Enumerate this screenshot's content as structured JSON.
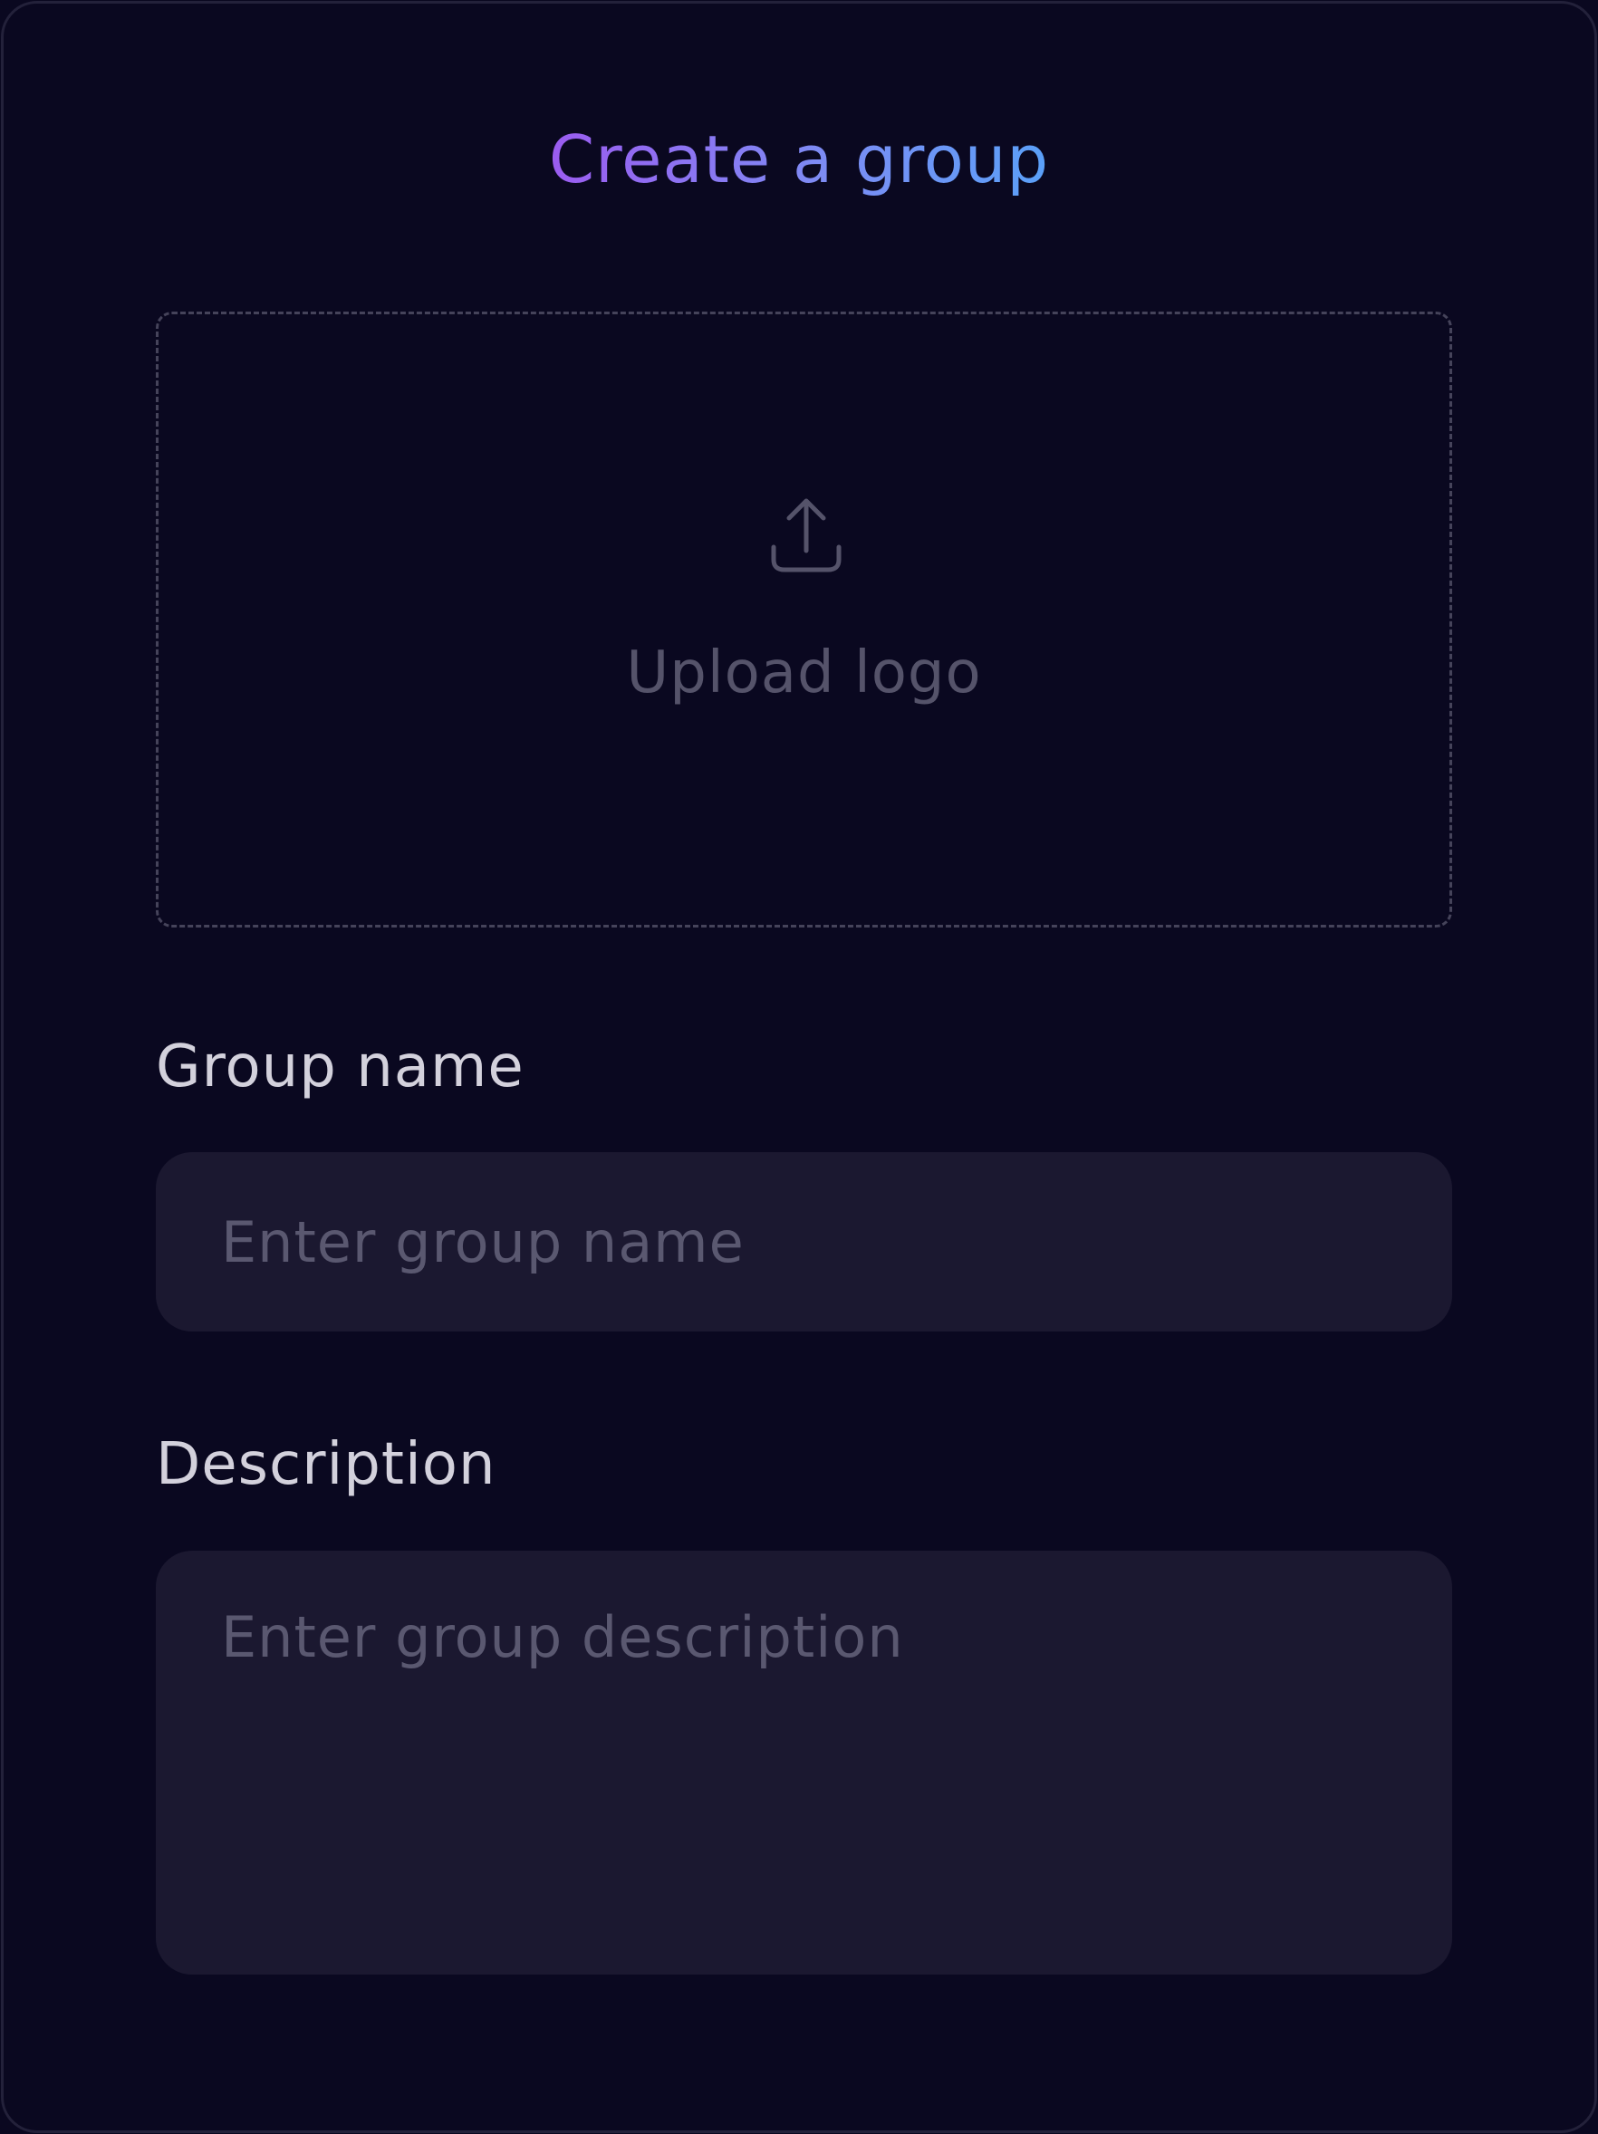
{
  "dialog": {
    "title": "Create a group",
    "title_gradient": [
      "#9b5cf0",
      "#5aa0f8"
    ],
    "background": "#0a0820"
  },
  "upload": {
    "icon": "upload-icon",
    "label": "Upload logo"
  },
  "group_name": {
    "label": "Group name",
    "value": "",
    "placeholder": "Enter group name"
  },
  "description": {
    "label": "Description",
    "value": "",
    "placeholder": "Enter group description"
  }
}
